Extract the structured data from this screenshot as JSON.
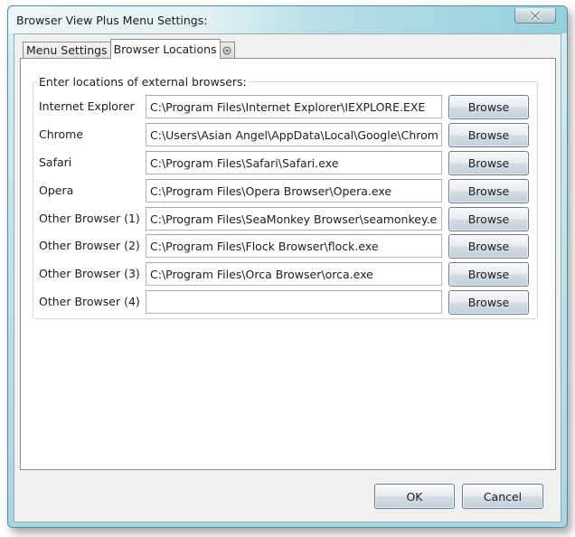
{
  "window": {
    "title": "Browser View Plus Menu Settings:",
    "close_icon": "close-icon"
  },
  "tabs": [
    {
      "label": "Menu Settings",
      "selected": false
    },
    {
      "label": "Browser Locations",
      "selected": true
    },
    {
      "label": "",
      "icon": "circle-dot-icon",
      "selected": false
    }
  ],
  "group": {
    "legend": "Enter locations of external browsers:",
    "browse_label": "Browse",
    "rows": [
      {
        "label": "Internet Explorer",
        "value": "C:\\Program Files\\Internet Explorer\\IEXPLORE.EXE"
      },
      {
        "label": "Chrome",
        "value": "C:\\Users\\Asian Angel\\AppData\\Local\\Google\\Chrome\\Application\\chrome.exe"
      },
      {
        "label": "Safari",
        "value": "C:\\Program Files\\Safari\\Safari.exe"
      },
      {
        "label": "Opera",
        "value": "C:\\Program Files\\Opera Browser\\Opera.exe"
      },
      {
        "label": "Other Browser (1)",
        "value": "C:\\Program Files\\SeaMonkey Browser\\seamonkey.exe"
      },
      {
        "label": "Other Browser (2)",
        "value": "C:\\Program Files\\Flock Browser\\flock.exe"
      },
      {
        "label": "Other Browser (3)",
        "value": "C:\\Program Files\\Orca Browser\\orca.exe"
      },
      {
        "label": "Other Browser (4)",
        "value": ""
      }
    ]
  },
  "footer": {
    "ok_label": "OK",
    "cancel_label": "Cancel"
  }
}
